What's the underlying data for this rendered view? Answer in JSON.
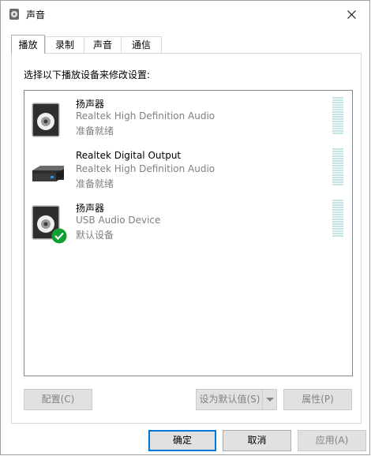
{
  "window": {
    "title": "声音",
    "close_icon": "close-icon"
  },
  "tabs": [
    {
      "label": "播放",
      "active": true
    },
    {
      "label": "录制",
      "active": false
    },
    {
      "label": "声音",
      "active": false
    },
    {
      "label": "通信",
      "active": false
    }
  ],
  "prompt": "选择以下播放设备来修改设置:",
  "devices": [
    {
      "name": "扬声器",
      "description": "Realtek High Definition Audio",
      "status": "准备就绪",
      "icon": "speaker-icon",
      "default": false
    },
    {
      "name": "Realtek Digital Output",
      "description": "Realtek High Definition Audio",
      "status": "准备就绪",
      "icon": "digital-output-icon",
      "default": false
    },
    {
      "name": "扬声器",
      "description": "USB Audio Device",
      "status": "默认设备",
      "icon": "speaker-icon",
      "default": true
    }
  ],
  "buttons": {
    "configure": "配置(C)",
    "set_default": "设为默认值(S)",
    "properties": "属性(P)",
    "ok": "确定",
    "cancel": "取消",
    "apply": "应用(A)"
  },
  "colors": {
    "accent": "#0078d7",
    "check": "#10a032",
    "meter": "#c5e4e4"
  }
}
